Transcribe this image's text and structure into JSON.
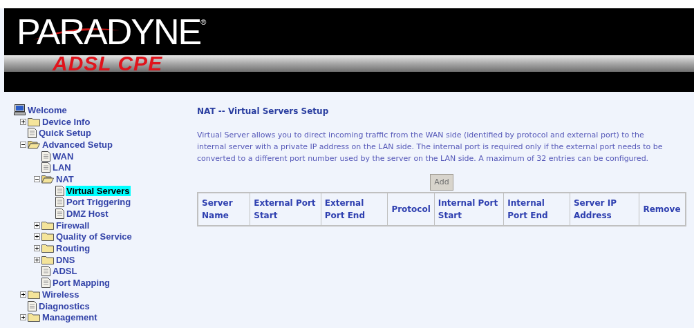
{
  "banner": {
    "brand": "PARADYNE",
    "registered": "®",
    "product": "ADSL CPE"
  },
  "tree": {
    "label": "Welcome",
    "kind": "computer",
    "selected": false,
    "children": [
      {
        "label": "Device Info",
        "kind": "folder",
        "expanded": false,
        "selected": false
      },
      {
        "label": "Quick Setup",
        "kind": "page",
        "selected": false
      },
      {
        "label": "Advanced Setup",
        "kind": "folder",
        "expanded": true,
        "selected": false,
        "children": [
          {
            "label": "WAN",
            "kind": "page",
            "selected": false
          },
          {
            "label": "LAN",
            "kind": "page",
            "selected": false
          },
          {
            "label": "NAT",
            "kind": "folder",
            "expanded": true,
            "selected": false,
            "children": [
              {
                "label": "Virtual Servers",
                "kind": "page",
                "selected": true
              },
              {
                "label": "Port Triggering",
                "kind": "page",
                "selected": false
              },
              {
                "label": "DMZ Host",
                "kind": "page",
                "selected": false
              }
            ]
          },
          {
            "label": "Firewall",
            "kind": "folder",
            "expanded": false,
            "selected": false
          },
          {
            "label": "Quality of Service",
            "kind": "folder",
            "expanded": false,
            "selected": false
          },
          {
            "label": "Routing",
            "kind": "folder",
            "expanded": false,
            "selected": false
          },
          {
            "label": "DNS",
            "kind": "folder",
            "expanded": false,
            "selected": false
          },
          {
            "label": "ADSL",
            "kind": "page",
            "selected": false
          },
          {
            "label": "Port Mapping",
            "kind": "page",
            "selected": false
          }
        ]
      },
      {
        "label": "Wireless",
        "kind": "folder",
        "expanded": false,
        "selected": false
      },
      {
        "label": "Diagnostics",
        "kind": "page",
        "selected": false
      },
      {
        "label": "Management",
        "kind": "folder",
        "expanded": false,
        "selected": false
      }
    ]
  },
  "page_title": "NAT -- Virtual Servers Setup",
  "description": "Virtual Server allows you to direct incoming traffic from the WAN side (identified by protocol and external port) to the internal server with a private IP address on the LAN side. The internal port is required only if the external port needs to be converted to a different port number used by the server on the LAN side. A maximum of 32 entries can be configured.",
  "add_button": "Add",
  "table": {
    "columns": [
      "Server Name",
      "External Port Start",
      "External Port End",
      "Protocol",
      "Internal Port Start",
      "Internal Port End",
      "Server IP Address",
      "Remove"
    ]
  }
}
